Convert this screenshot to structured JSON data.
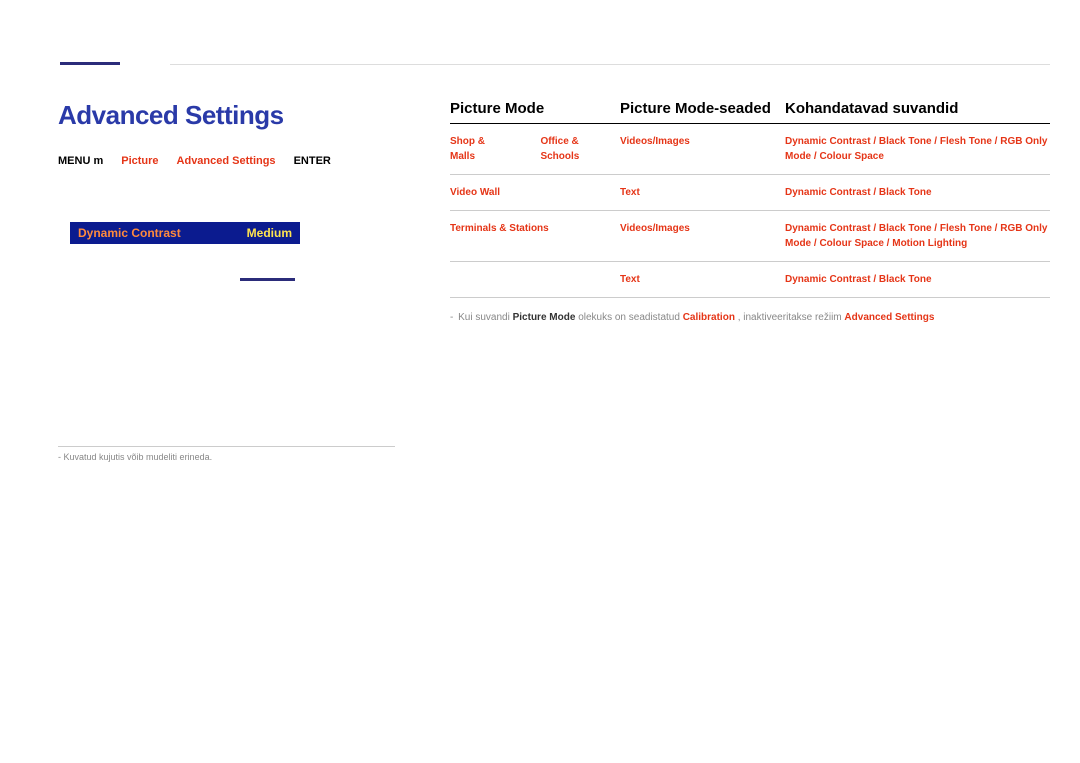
{
  "page": {
    "title": "Advanced Settings"
  },
  "breadcrumb": {
    "menu": "MENU m",
    "picture": "Picture",
    "adv": "Advanced Settings",
    "enter": "ENTER"
  },
  "setting": {
    "label": "Dynamic Contrast",
    "value": "Medium"
  },
  "footnote_left": "- Kuvatud kujutis võib mudeliti erineda.",
  "table": {
    "headers": {
      "h1": "Picture Mode",
      "h2": "Picture Mode-seaded",
      "h3": "Kohandatavad suvandid"
    },
    "rows": [
      {
        "c1a": "Shop & Malls",
        "c1b": "Office & Schools",
        "c2": "Videos/Images",
        "c3": "Dynamic Contrast / Black Tone / Flesh Tone / RGB Only Mode / Colour Space"
      },
      {
        "c1a": "Video Wall",
        "c1b": "",
        "c2": "Text",
        "c3": "Dynamic Contrast / Black Tone"
      },
      {
        "c1a": "Terminals & Stations",
        "c1b": "",
        "c2": "Videos/Images",
        "c3": "Dynamic Contrast / Black Tone / Flesh Tone / RGB Only Mode / Colour Space / Motion Lighting"
      },
      {
        "c1a": "",
        "c1b": "",
        "c2": "Text",
        "c3": "Dynamic Contrast / Black Tone"
      }
    ]
  },
  "note": {
    "prefix": "Kui suvandi ",
    "pm": "Picture Mode",
    "mid": " olekuks on seadistatud ",
    "cal": "Calibration",
    "mid2": ", inaktiveeritakse režiim ",
    "adv": "Advanced Settings"
  }
}
